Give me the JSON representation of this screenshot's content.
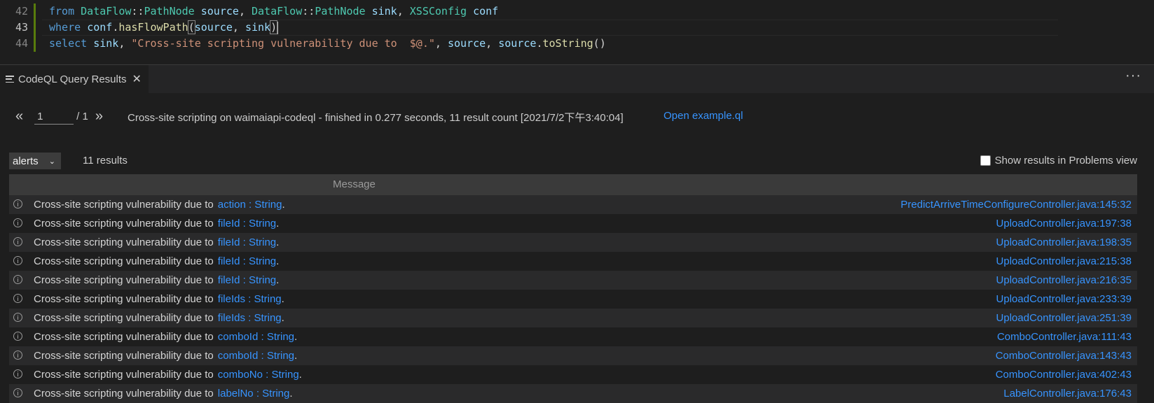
{
  "editor": {
    "lines": [
      {
        "num": "42"
      },
      {
        "num": "43"
      },
      {
        "num": "44"
      }
    ],
    "code42": {
      "t1": "from",
      "t2": "DataFlow",
      "t3": "::",
      "t4": "PathNode",
      "t5": "source",
      "t6": ",",
      "t7": "DataFlow",
      "t8": "::",
      "t9": "PathNode",
      "t10": "sink",
      "t11": ",",
      "t12": "XSSConfig",
      "t13": "conf"
    },
    "code43": {
      "t1": "where",
      "t2": "conf",
      "t3": ".",
      "t4": "hasFlowPath",
      "t5": "(",
      "t6": "source",
      "t7": ", ",
      "t8": "sink",
      "t9": ")"
    },
    "code44": {
      "t1": "select",
      "t2": "sink",
      "t3": ", ",
      "t4": "\"Cross-site scripting vulnerability due to  $@.\"",
      "t5": ", ",
      "t6": "source",
      "t7": ", ",
      "t8": "source",
      "t9": ".",
      "t10": "toString",
      "t11": "()"
    }
  },
  "panel": {
    "tab_label": "CodeQL Query Results",
    "tab_close": "✕",
    "more": "···"
  },
  "pager": {
    "prev": "«",
    "page": "1",
    "total": "/ 1",
    "next": "»"
  },
  "status": "Cross-site scripting on waimaiapi-codeql - finished in 0.277 seconds, 11 result count [2021/7/2下午3:40:04]",
  "open_link": "Open example.ql",
  "result_set": {
    "selected": "alerts",
    "chevron": "⌄"
  },
  "result_count": "11 results",
  "problems_label": "Show results in Problems view",
  "table": {
    "header": "Message",
    "rows": [
      {
        "msg": "Cross-site scripting vulnerability due to",
        "src": "action : String",
        "loc": "PredictArriveTimeConfigureController.java:145:32"
      },
      {
        "msg": "Cross-site scripting vulnerability due to",
        "src": "fileId : String",
        "loc": "UploadController.java:197:38"
      },
      {
        "msg": "Cross-site scripting vulnerability due to",
        "src": "fileId : String",
        "loc": "UploadController.java:198:35"
      },
      {
        "msg": "Cross-site scripting vulnerability due to",
        "src": "fileId : String",
        "loc": "UploadController.java:215:38"
      },
      {
        "msg": "Cross-site scripting vulnerability due to",
        "src": "fileId : String",
        "loc": "UploadController.java:216:35"
      },
      {
        "msg": "Cross-site scripting vulnerability due to",
        "src": "fileIds : String",
        "loc": "UploadController.java:233:39"
      },
      {
        "msg": "Cross-site scripting vulnerability due to",
        "src": "fileIds : String",
        "loc": "UploadController.java:251:39"
      },
      {
        "msg": "Cross-site scripting vulnerability due to",
        "src": "comboId : String",
        "loc": "ComboController.java:111:43"
      },
      {
        "msg": "Cross-site scripting vulnerability due to",
        "src": "comboId : String",
        "loc": "ComboController.java:143:43"
      },
      {
        "msg": "Cross-site scripting vulnerability due to",
        "src": "comboNo : String",
        "loc": "ComboController.java:402:43"
      },
      {
        "msg": "Cross-site scripting vulnerability due to",
        "src": "labelNo : String",
        "loc": "LabelController.java:176:43"
      }
    ],
    "dot": "."
  }
}
